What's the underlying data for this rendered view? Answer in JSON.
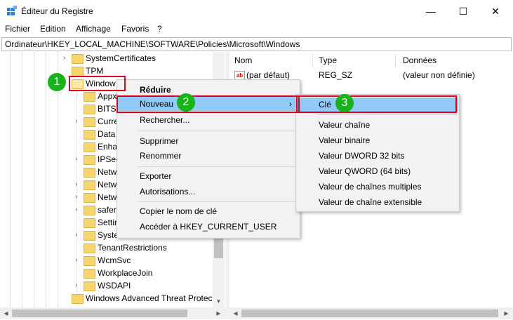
{
  "window": {
    "title": "Éditeur du Registre",
    "minimize": "—",
    "maximize": "☐",
    "close": "✕"
  },
  "menubar": [
    "Fichier",
    "Edition",
    "Affichage",
    "Favoris",
    "?"
  ],
  "address": "Ordinateur\\HKEY_LOCAL_MACHINE\\SOFTWARE\\Policies\\Microsoft\\Windows",
  "tree": {
    "items": [
      "SystemCertificates",
      "TPM",
      "Window",
      "Appx",
      "BITS",
      "Curre",
      "Data",
      "Enha",
      "IPSec",
      "Netw",
      "Netw",
      "Netw",
      "safer",
      "Settir",
      "Syster",
      "TenantRestrictions",
      "WcmSvc",
      "WorkplaceJoin",
      "WSDAPI",
      "Windows Advanced Threat Protect"
    ]
  },
  "values_list": {
    "headers": {
      "name": "Nom",
      "type": "Type",
      "data": "Données"
    },
    "rows": [
      {
        "name": "(par défaut)",
        "type": "REG_SZ",
        "data": "(valeur non définie)",
        "icon": "ab-icon"
      }
    ]
  },
  "context_menu": {
    "items": [
      "Réduire",
      "Nouveau",
      "Rechercher...",
      "Supprimer",
      "Renommer",
      "Exporter",
      "Autorisations...",
      "Copier le nom de clé",
      "Accéder à HKEY_CURRENT_USER"
    ],
    "submenu_arrow": "›"
  },
  "submenu": {
    "items": [
      "Clé",
      "Valeur chaîne",
      "Valeur binaire",
      "Valeur DWORD 32 bits",
      "Valeur QWORD (64 bits)",
      "Valeur de chaînes multiples",
      "Valeur de chaîne extensible"
    ]
  },
  "badges": [
    "1",
    "2",
    "3"
  ],
  "colors": {
    "highlight": "#91c9f7",
    "callout_red": "#e0001b",
    "badge_green": "#16b31b",
    "folder": "#f5d66e"
  }
}
